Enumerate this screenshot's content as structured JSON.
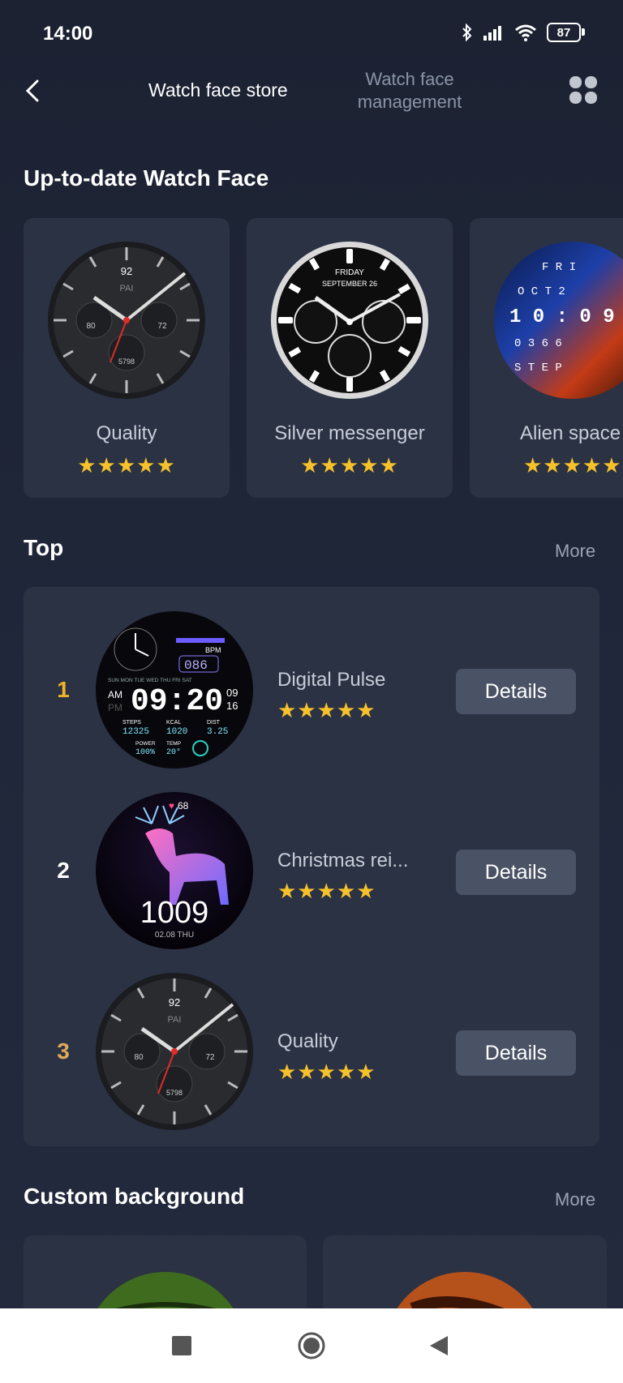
{
  "status": {
    "time": "14:00",
    "battery": "87"
  },
  "header": {
    "tab_store": "Watch face store",
    "tab_management": "Watch face management"
  },
  "latest": {
    "title": "Up-to-date Watch Face",
    "items": [
      {
        "name": "Quality",
        "stars": "★★★★★",
        "face_top": "92",
        "face_pai": "PAI",
        "face_left": "80",
        "face_right": "72",
        "face_bottom": "5798"
      },
      {
        "name": "Silver messenger",
        "stars": "★★★★★",
        "face_day": "FRIDAY",
        "face_date": "SEPTEMBER 26"
      },
      {
        "name": "Alien space",
        "stars": "★★★★★",
        "face_lines": [
          "F R I",
          "O C T 2",
          "1 0 : 0 9",
          "0 3 6 6",
          "S T E P"
        ]
      }
    ]
  },
  "top": {
    "title": "Top",
    "more": "More",
    "rows": [
      {
        "rank": "1",
        "name": "Digital Pulse",
        "stars": "★★★★★",
        "details": "Details",
        "rank_color": "#f0b429",
        "face": {
          "bpm_label": "BPM",
          "bpm": "086",
          "days": "SUN MON TUE WED THU FRI SAT",
          "ampm": "AM",
          "pm": "PM",
          "time": "09:20",
          "date_top": "09",
          "date_bottom": "16",
          "steps_label": "STEPS",
          "steps": "12325",
          "kcal_label": "KCAL",
          "kcal": "1020",
          "dist_label": "DIST",
          "dist": "3.25",
          "power_label": "POWER",
          "power": "100%",
          "temp_label": "TEMP",
          "temp": "20°"
        }
      },
      {
        "rank": "2",
        "name": "Christmas rei...",
        "stars": "★★★★★",
        "details": "Details",
        "rank_color": "#ffffff",
        "face": {
          "heart": "68",
          "time": "1009",
          "date": "02.08 THU"
        }
      },
      {
        "rank": "3",
        "name": "Quality",
        "stars": "★★★★★",
        "details": "Details",
        "rank_color": "#e0a95a",
        "face": {
          "top": "92",
          "pai": "PAI",
          "left": "80",
          "right": "72",
          "bottom": "5798"
        }
      }
    ]
  },
  "custom": {
    "title": "Custom background",
    "more": "More"
  },
  "colors": {
    "star": "#f6c12b",
    "panel": "#2b3244",
    "button": "#4a5265"
  },
  "icons": [
    "back-arrow-icon",
    "grid-icon",
    "bluetooth-icon",
    "signal-icon",
    "wifi-icon",
    "battery-icon",
    "nav-square-icon",
    "nav-circle-icon",
    "nav-back-icon"
  ]
}
